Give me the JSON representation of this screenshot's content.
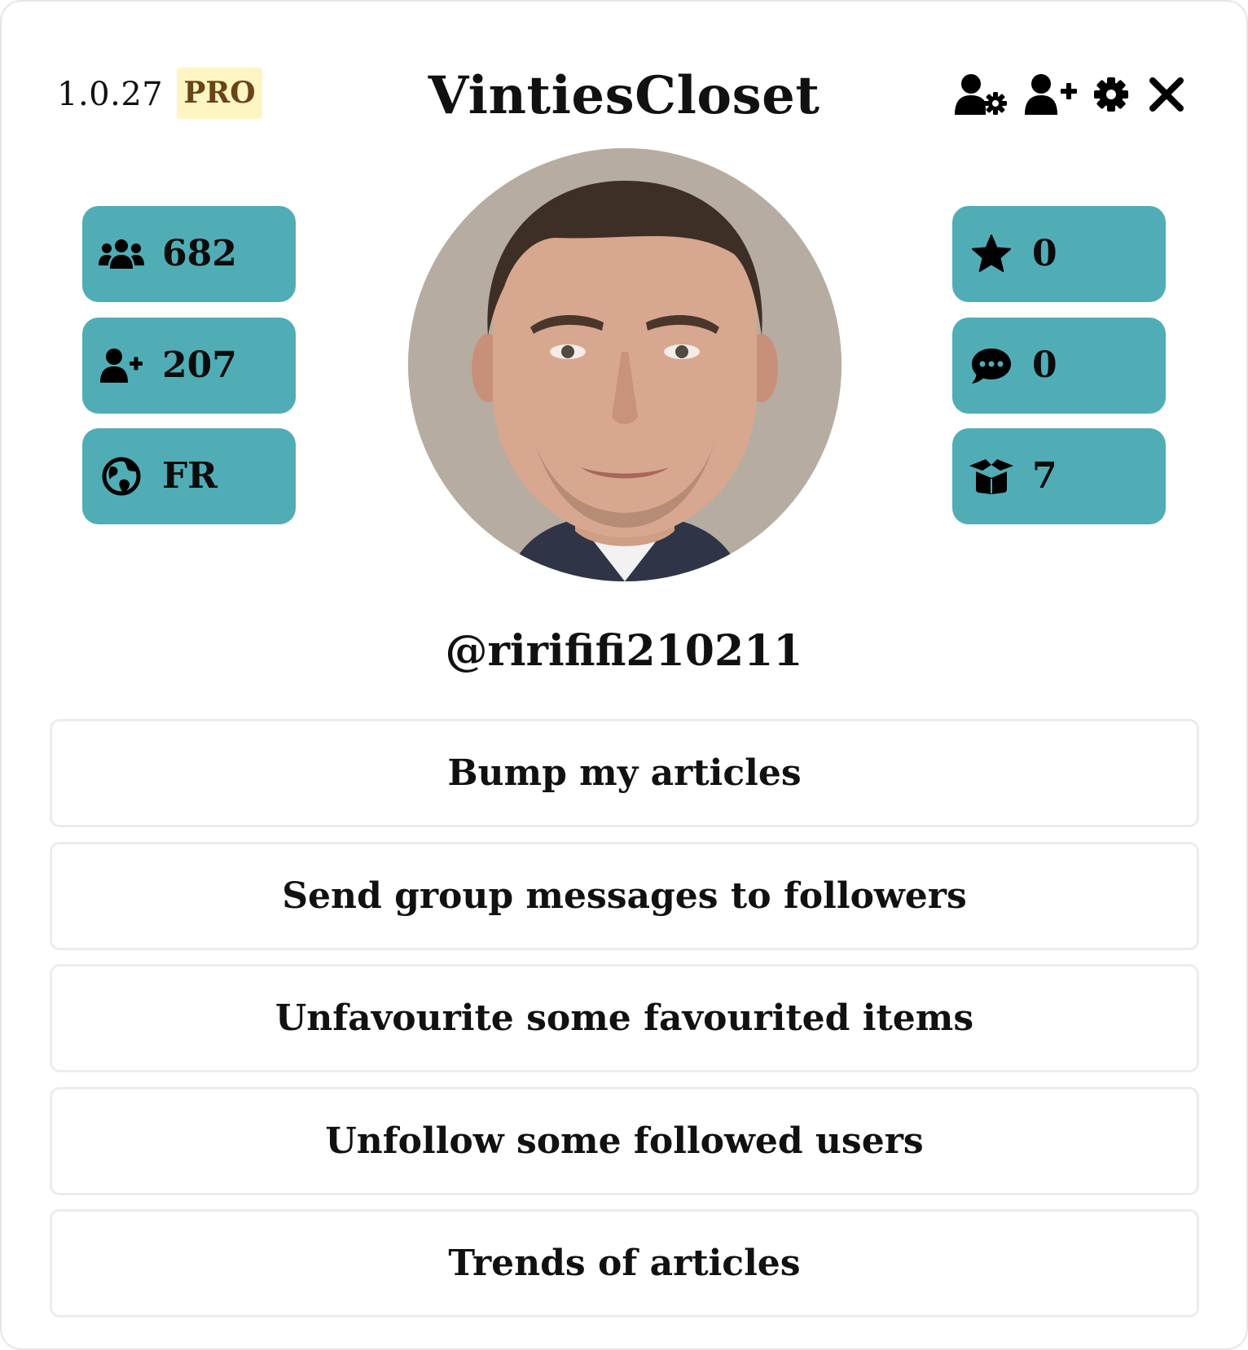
{
  "header": {
    "version": "1.0.27",
    "badge": "PRO",
    "title": "VintiesCloset",
    "icons": [
      "user-settings-icon",
      "user-plus-icon",
      "gear-icon",
      "close-icon"
    ]
  },
  "stats": {
    "left": [
      {
        "icon": "users-group-icon",
        "value": "682"
      },
      {
        "icon": "user-plus-icon",
        "value": "207"
      },
      {
        "icon": "globe-icon",
        "value": "FR"
      }
    ],
    "right": [
      {
        "icon": "star-icon",
        "value": "0"
      },
      {
        "icon": "chat-bubble-icon",
        "value": "0"
      },
      {
        "icon": "box-open-icon",
        "value": "7"
      }
    ]
  },
  "profile": {
    "username": "@rirififi210211"
  },
  "actions": [
    "Bump my articles",
    "Send group messages to followers",
    "Unfavourite some favourited items",
    "Unfollow some followed users",
    "Trends of articles"
  ],
  "colors": {
    "pill": "#50adb6",
    "badge_bg": "#fdf6c3",
    "badge_text": "#6b4415",
    "button_border": "#ececec"
  }
}
